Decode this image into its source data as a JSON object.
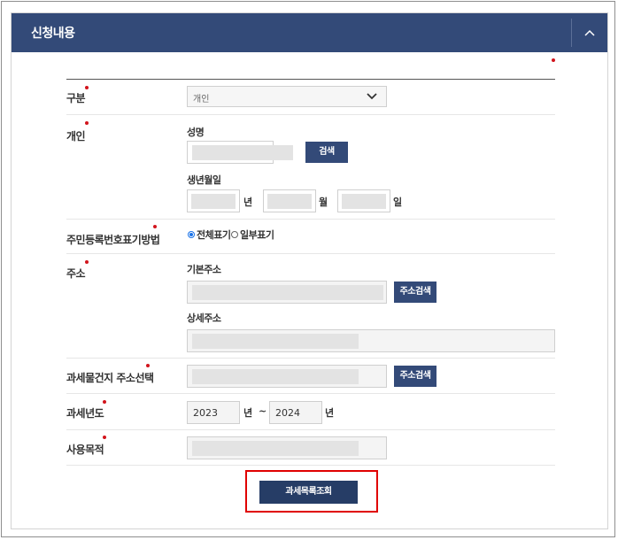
{
  "section": {
    "title": "신청내용",
    "collapse_icon": "chevron-up-icon"
  },
  "form": {
    "type": {
      "label": "구분",
      "selected": "개인"
    },
    "individual": {
      "label": "개인",
      "name_label": "성명",
      "search_button": "검색",
      "birth_label": "생년월일",
      "year_unit": "년",
      "month_unit": "월",
      "day_unit": "일"
    },
    "rrn_display": {
      "label": "주민등록번호표기방법",
      "options": [
        "전체표기",
        "일부표기"
      ],
      "selected": "전체표기"
    },
    "address": {
      "label": "주소",
      "basic_label": "기본주소",
      "basic_search_button": "주소검색",
      "detail_label": "상세주소"
    },
    "tax_property_address": {
      "label": "과세물건지 주소선택",
      "search_button": "주소검색"
    },
    "tax_year": {
      "label": "과세년도",
      "from": "2023",
      "from_unit": "년",
      "tilde": "~",
      "to": "2024",
      "to_unit": "년"
    },
    "purpose": {
      "label": "사용목적"
    }
  },
  "submit_button": "과세목록조회",
  "colors": {
    "header": "#334a78",
    "button": "#334a78",
    "required": "#d2141c",
    "highlight": "#e00000"
  }
}
